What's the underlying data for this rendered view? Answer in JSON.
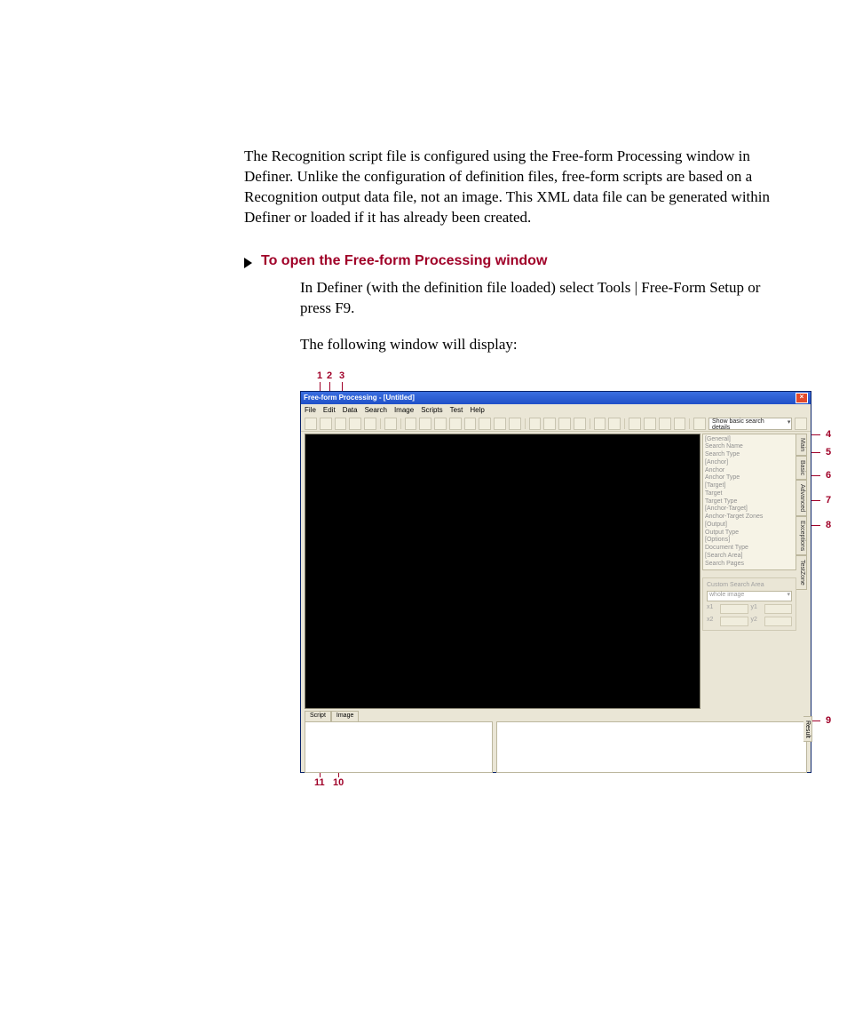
{
  "intro_paragraph": "The Recognition script file is configured using the Free-form Processing window in Definer. Unlike the configuration of definition files, free-form scripts are based on a Recognition output data file, not an image. This XML data file can be generated within Definer or loaded if it has already been created.",
  "procedure_heading": "To open the Free-form Processing window",
  "step1": "In Definer (with the definition file loaded) select Tools | Free-Form Setup or press F9.",
  "step1_followup": "The following window will display:",
  "callouts": {
    "top": [
      "1",
      "2",
      "3"
    ],
    "right": [
      "4",
      "5",
      "6",
      "7",
      "8",
      "9"
    ],
    "bottom_left": "11",
    "bottom_right": "10"
  },
  "app": {
    "title": "Free-form Processing - [Untitled]",
    "menus": [
      "File",
      "Edit",
      "Data",
      "Search",
      "Image",
      "Scripts",
      "Test",
      "Help"
    ],
    "toolbar_combo": "Show basic search details",
    "properties": [
      "[General]",
      "Search Name",
      "Search Type",
      "[Anchor]",
      "Anchor",
      "Anchor Type",
      "[Target]",
      "Target",
      "Target Type",
      "[Anchor-Target]",
      "Anchor-Target Zones",
      "[Output]",
      "Output Type",
      "[Options]",
      "Document Type",
      "[Search Area]",
      "Search Pages"
    ],
    "custom_area": {
      "header": "Custom Search Area",
      "dropdown": "whole image",
      "x1_label": "x1",
      "y1_label": "y1",
      "x2_label": "x2",
      "y2_label": "y2"
    },
    "side_tabs": [
      "Main",
      "Basic",
      "Advanced",
      "Exceptions",
      "TestZone"
    ],
    "bottom_tabs": [
      "Script",
      "Image"
    ],
    "result_tab": "Result"
  }
}
